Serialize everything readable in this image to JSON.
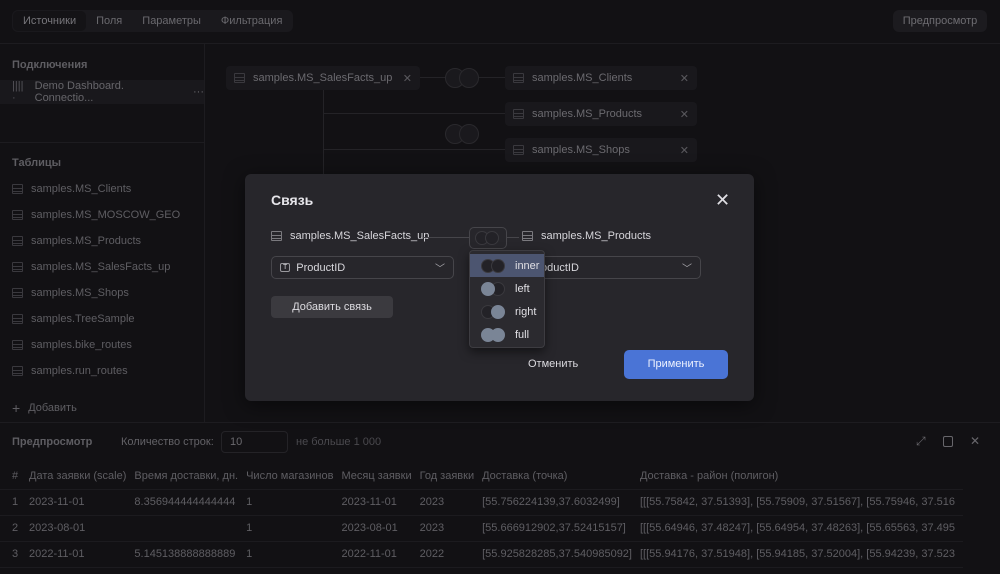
{
  "tabs": [
    {
      "label": "Источники",
      "active": true
    },
    {
      "label": "Поля"
    },
    {
      "label": "Параметры"
    },
    {
      "label": "Фильтрация"
    }
  ],
  "preview_button": "Предпросмотр",
  "sidebar": {
    "connections_title": "Подключения",
    "connection": "Demo Dashboard. Connectio...",
    "tables_title": "Таблицы",
    "tables": [
      "samples.MS_Clients",
      "samples.MS_MOSCOW_GEO",
      "samples.MS_Products",
      "samples.MS_SalesFacts_up",
      "samples.MS_Shops",
      "samples.TreeSample",
      "samples.bike_routes",
      "samples.run_routes"
    ],
    "add_label": "Добавить"
  },
  "canvas": {
    "main_node": "samples.MS_SalesFacts_up",
    "joined": [
      "samples.MS_Clients",
      "samples.MS_Products",
      "samples.MS_Shops"
    ]
  },
  "dialog": {
    "title": "Связь",
    "left_source": "samples.MS_SalesFacts_up",
    "right_source": "samples.MS_Products",
    "left_field": "ProductID",
    "right_field": "ProductID",
    "add_link": "Добавить связь",
    "cancel": "Отменить",
    "apply": "Применить",
    "join_types": [
      "inner",
      "left",
      "right",
      "full"
    ],
    "selected_join": "inner",
    "apply_color": "#4a74d6"
  },
  "preview": {
    "title": "Предпросмотр",
    "rows_label": "Количество строк:",
    "rows_value": "10",
    "rows_hint": "не больше 1 000",
    "columns": [
      "#",
      "Дата заявки (scale)",
      "Время доставки, дн.",
      "Число магазинов",
      "Месяц заявки",
      "Год заявки",
      "Доставка (точка)",
      "Доставка - район (полигон)"
    ],
    "rows": [
      [
        "1",
        "2023-11-01",
        "8.356944444444444",
        "1",
        "2023-11-01",
        "2023",
        "[55.756224139,37.6032499]",
        "[[[55.75842, 37.51393], [55.75909, 37.51567], [55.75946, 37.516"
      ],
      [
        "2",
        "2023-08-01",
        "",
        "1",
        "2023-08-01",
        "2023",
        "[55.666912902,37.52415157]",
        "[[[55.64946, 37.48247], [55.64954, 37.48263], [55.65563, 37.495"
      ],
      [
        "3",
        "2022-11-01",
        "5.145138888888889",
        "1",
        "2022-11-01",
        "2022",
        "[55.925828285,37.540985092]",
        "[[[55.94176, 37.51948], [55.94185, 37.52004], [55.94239, 37.523"
      ]
    ]
  }
}
